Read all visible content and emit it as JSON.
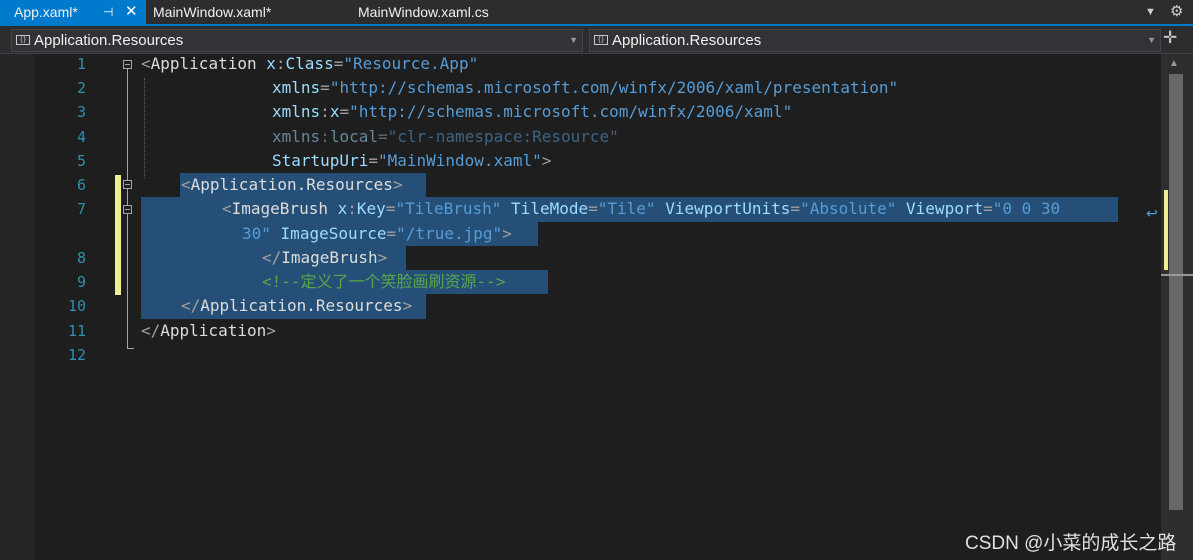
{
  "tabs": [
    {
      "label": "App.xaml*",
      "active": true
    },
    {
      "label": "MainWindow.xaml*",
      "active": false
    },
    {
      "label": "MainWindow.xaml.cs",
      "active": false
    }
  ],
  "tab_icons": {
    "pin": "pin-icon",
    "close": "close-icon",
    "dropdown": "chevron-down-icon",
    "settings": "gear-icon"
  },
  "nav": {
    "left_combo": "Application.Resources",
    "right_combo": "Application.Resources"
  },
  "line_numbers": [
    "1",
    "2",
    "3",
    "4",
    "5",
    "6",
    "7",
    "8",
    "9",
    "10",
    "11",
    "12"
  ],
  "code": {
    "l1": {
      "open": "<",
      "tag": "Application",
      "xpfx": "x",
      "colon": ":",
      "attr": "Class",
      "eq": "=",
      "val": "\"Resource.App\""
    },
    "l2": {
      "attr": "xmlns",
      "eq": "=",
      "val": "\"http://schemas.microsoft.com/winfx/2006/xaml/presentation\""
    },
    "l3": {
      "attr": "xmlns",
      "colon": ":",
      "attr2": "x",
      "eq": "=",
      "val": "\"http://schemas.microsoft.com/winfx/2006/xaml\""
    },
    "l4": {
      "attr": "xmlns",
      "colon": ":",
      "attr2": "local",
      "eq": "=",
      "val": "\"clr-namespace:Resource\""
    },
    "l5": {
      "attr": "StartupUri",
      "eq": "=",
      "val": "\"MainWindow.xaml\"",
      "close": ">"
    },
    "l6": {
      "open": "<",
      "tag": "Application.Resources",
      "close": ">"
    },
    "l7": {
      "open": "<",
      "tag": "ImageBrush",
      "xpfx": "x",
      "colon": ":",
      "key_attr": "Key",
      "eq": "=",
      "key_val": "\"TileBrush\"",
      "tm_attr": "TileMode",
      "tm_val": "\"Tile\"",
      "vu_attr": "ViewportUnits",
      "vu_val": "\"Absolute\"",
      "vp_attr": "Viewport",
      "vp_val": "\"0 0 30"
    },
    "l7b": {
      "vp_val_end": "30\"",
      "is_attr": "ImageSource",
      "eq": "=",
      "is_val": "\"/true.jpg\"",
      "close": ">"
    },
    "l8": {
      "open": "</",
      "tag": "ImageBrush",
      "close": ">"
    },
    "l9": {
      "comment": "<!--定义了一个笑脸画刷资源-->"
    },
    "l10": {
      "open": "</",
      "tag": "Application.Resources",
      "close": ">"
    },
    "l11": {
      "open": "</",
      "tag": "Application",
      "close": ">"
    }
  },
  "watermark": "CSDN @小菜的成长之路"
}
